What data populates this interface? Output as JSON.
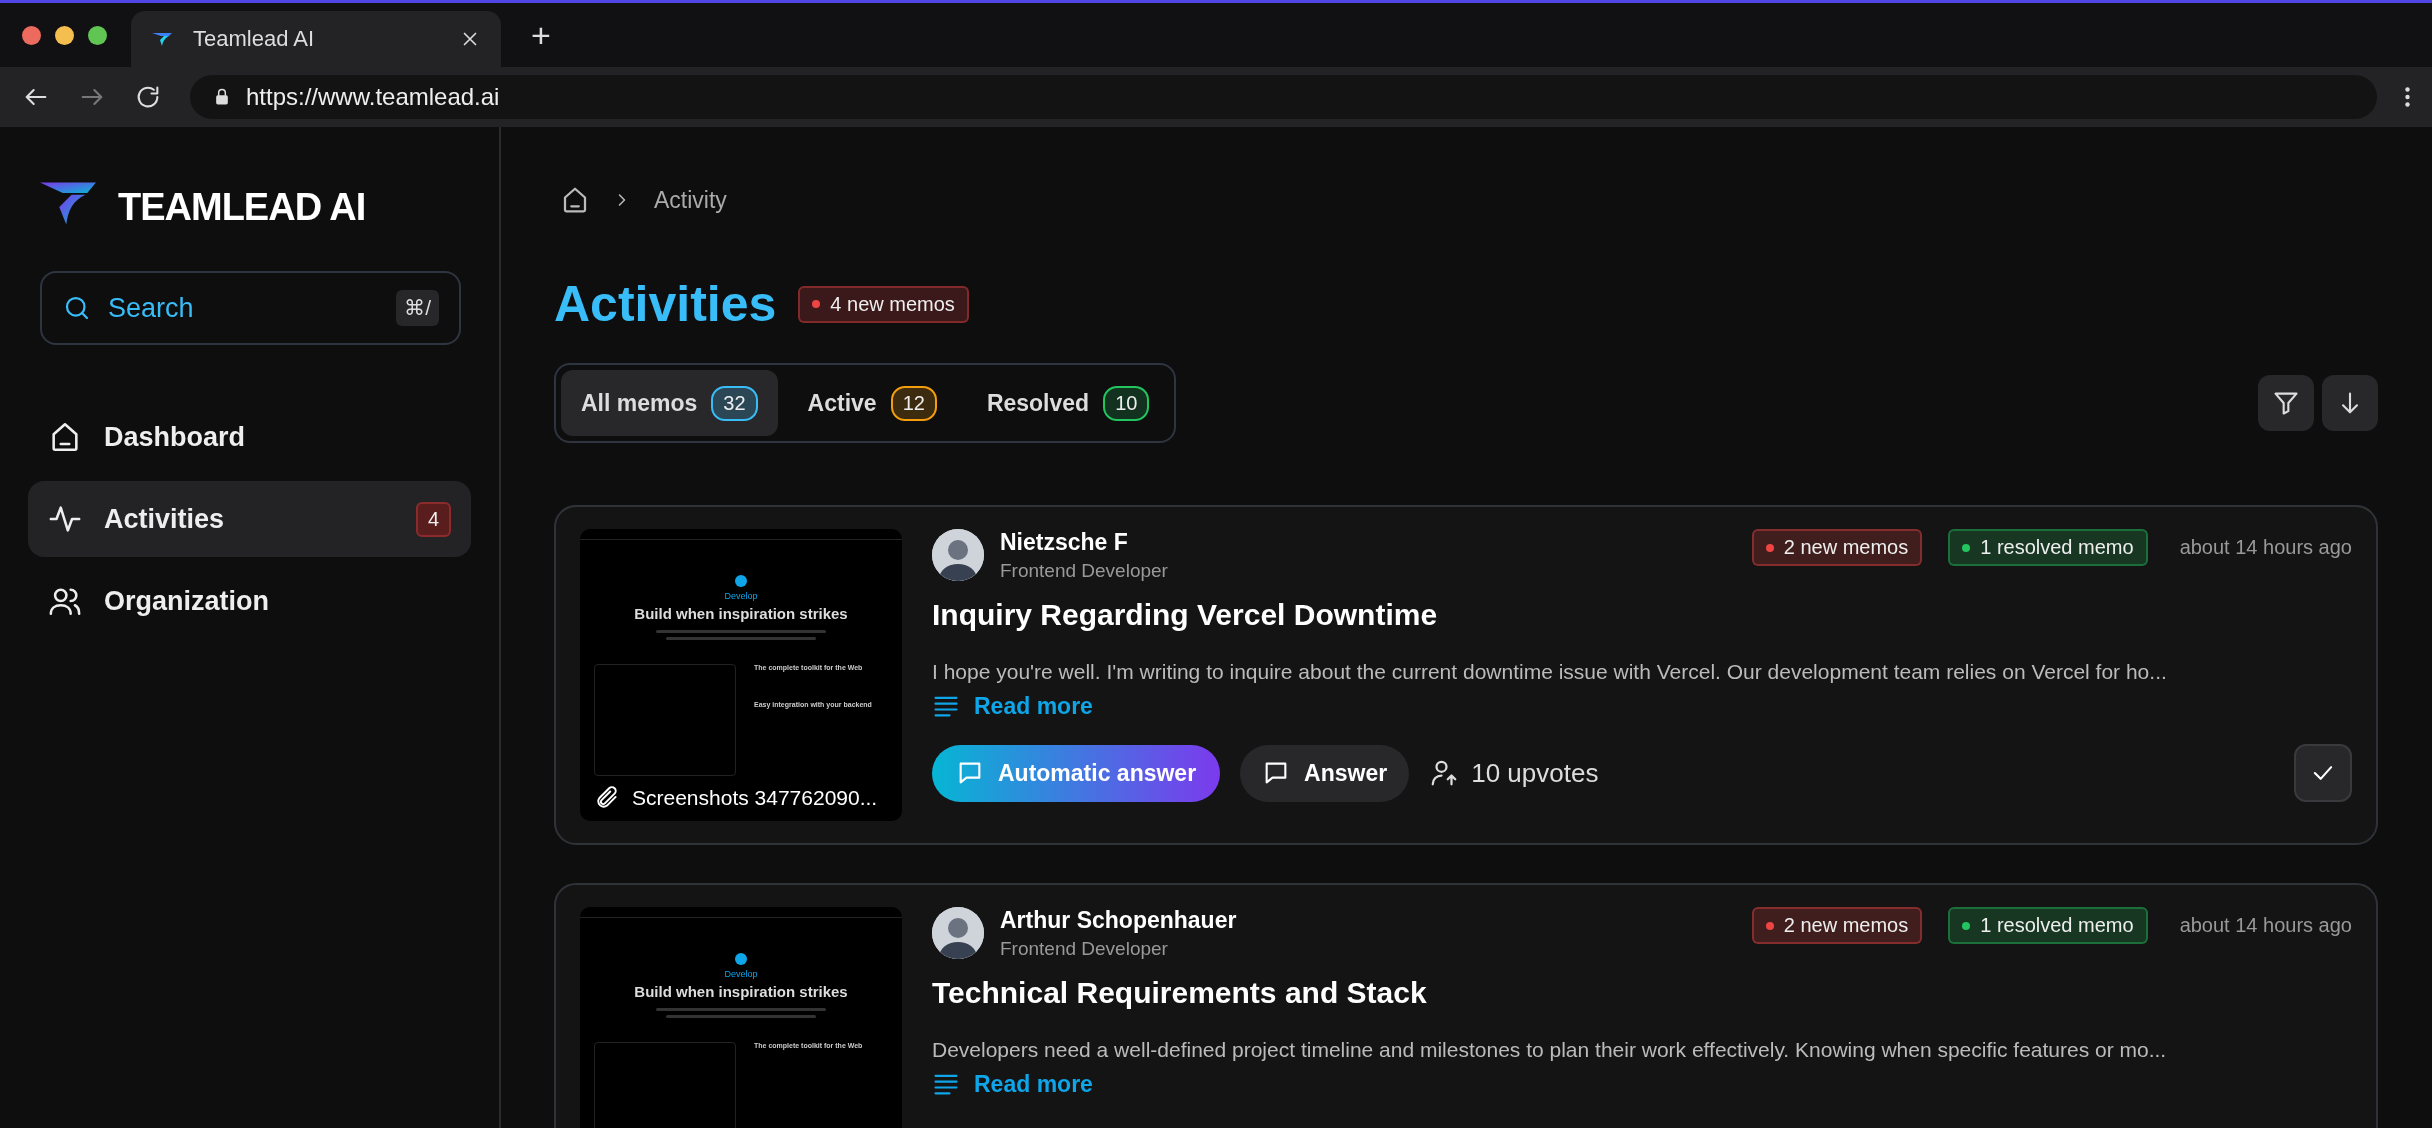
{
  "browser": {
    "tab_title": "Teamlead AI",
    "new_tab": "+",
    "url": "https://www.teamlead.ai"
  },
  "sidebar": {
    "logo_text": "TEAMLEAD AI",
    "search": {
      "placeholder": "Search",
      "shortcut": "⌘/"
    },
    "items": [
      {
        "label": "Dashboard",
        "selected": false
      },
      {
        "label": "Activities",
        "selected": true,
        "badge": "4"
      },
      {
        "label": "Organization",
        "selected": false
      }
    ]
  },
  "breadcrumb": {
    "current": "Activity"
  },
  "heading": {
    "title": "Activities",
    "badge": "4 new memos"
  },
  "filters": [
    {
      "label": "All memos",
      "count": "32",
      "selected": true,
      "color": "#38bdf8"
    },
    {
      "label": "Active",
      "count": "12",
      "selected": false,
      "color": "#f59e0b"
    },
    {
      "label": "Resolved",
      "count": "10",
      "selected": false,
      "color": "#22c55e"
    }
  ],
  "memos": [
    {
      "thumbnail": {
        "eyebrow": "Develop",
        "headline": "Build when inspiration strikes",
        "features": [
          "The complete toolkit for the Web",
          "Easy integration with your backend"
        ]
      },
      "attachment": "Screenshots 347762090...",
      "author": "Nietzsche F",
      "role": "Frontend Developer",
      "tags": [
        {
          "label": "2 new memos",
          "color": "#ef4444"
        },
        {
          "label": "1 resolved memo",
          "color": "#22c55e"
        }
      ],
      "time": "about 14 hours ago",
      "title": "Inquiry Regarding Vercel Downtime",
      "excerpt": "I hope you're well. I'm writing to inquire about the current downtime issue with Vercel. Our development team relies on Vercel for ho...",
      "read_more": "Read more",
      "actions": {
        "auto_answer": "Automatic answer",
        "answer": "Answer",
        "upvotes": "10 upvotes"
      }
    },
    {
      "thumbnail": {
        "eyebrow": "Develop",
        "headline": "Build when inspiration strikes",
        "features": [
          "The complete toolkit for the Web"
        ]
      },
      "author": "Arthur Schopenhauer",
      "role": "Frontend Developer",
      "tags": [
        {
          "label": "2 new memos",
          "color": "#ef4444"
        },
        {
          "label": "1 resolved memo",
          "color": "#22c55e"
        }
      ],
      "time": "about 14 hours ago",
      "title": "Technical Requirements and Stack",
      "excerpt": "Developers need a well-defined project timeline and milestones to plan their work effectively. Knowing when specific features or mo...",
      "read_more": "Read more"
    }
  ]
}
